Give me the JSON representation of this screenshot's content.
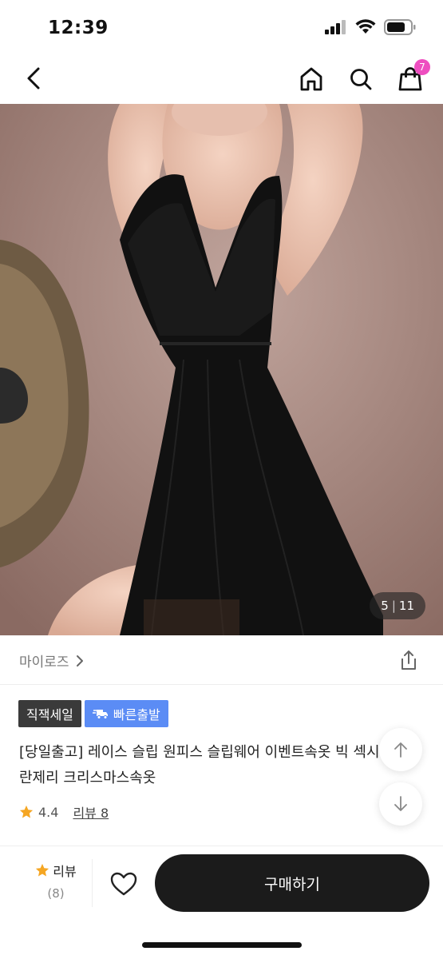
{
  "status": {
    "time": "12:39"
  },
  "nav": {
    "cart_count": "7"
  },
  "gallery": {
    "current": "5",
    "separator": "|",
    "total": "11"
  },
  "seller": {
    "name": "마이로즈"
  },
  "tags": [
    {
      "label": "직잭세일"
    },
    {
      "label": "빠른출발"
    }
  ],
  "product": {
    "title": "[당일출고] 레이스 슬립 원피스 슬립웨어 이벤트속옷 빅 섹시 란제리 크리스마스속옷",
    "rating": "4.4",
    "review_link": "리뷰 8"
  },
  "bottom": {
    "review_label": "리뷰",
    "review_count": "(8)",
    "buy_label": "구매하기"
  },
  "colors": {
    "accent_pink": "#ee4ec0",
    "tag_blue": "#5b8cf5",
    "star": "#f5a623",
    "buy_button": "#1b1b1b"
  }
}
